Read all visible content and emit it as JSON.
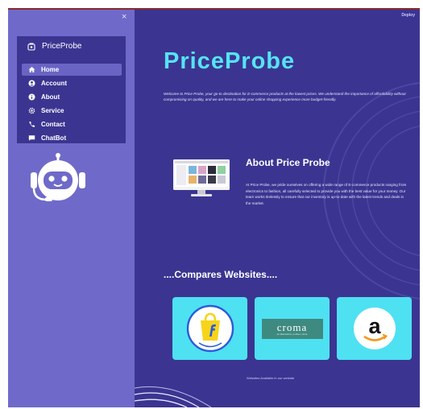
{
  "sidebar": {
    "close_label": "×",
    "brand": "PriceProbe",
    "items": [
      {
        "label": "Home",
        "icon": "home-icon",
        "active": true
      },
      {
        "label": "Account",
        "icon": "account-icon",
        "active": false
      },
      {
        "label": "About",
        "icon": "info-icon",
        "active": false
      },
      {
        "label": "Service",
        "icon": "gear-icon",
        "active": false
      },
      {
        "label": "Contact",
        "icon": "phone-icon",
        "active": false
      },
      {
        "label": "ChatBot",
        "icon": "chat-icon",
        "active": false
      }
    ]
  },
  "header": {
    "deploy_label": "Deploy"
  },
  "hero": {
    "title": "PriceProbe",
    "welcome": "Welcome to Price Probe, your go-to destination for E-commerce products at the lowest prices. We understand the importance of affordability without compromising on quality, and we are here to make your online shopping experience more budget-friendly."
  },
  "about": {
    "title": "About Price Probe",
    "text": "At Price Probe, we pride ourselves on offering a wide range of E-commerce products ranging from electronics to fashion, all carefully selected to provide you with the best value for your money. Our team works tirelessly to ensure that our inventory is up-to-date with the latest trends and deals in the market."
  },
  "compares": {
    "title": "....Compares Websites....",
    "sites": [
      {
        "name": "Flipkart",
        "icon": "flipkart-logo-icon"
      },
      {
        "name": "croma",
        "tagline": "an altersanics | online | store",
        "icon": "croma-logo-icon"
      },
      {
        "name": "a",
        "icon": "amazon-logo-icon"
      }
    ],
    "footer": "Websites Available in our website"
  },
  "colors": {
    "main_bg": "#3b3591",
    "sidebar_bg": "#6f6ac9",
    "accent": "#56e3f4",
    "card_bg": "#4ee1f2",
    "croma_green": "#3f8a80"
  }
}
